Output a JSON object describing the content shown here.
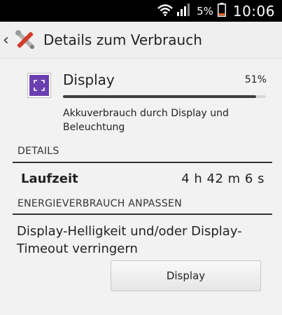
{
  "status_bar": {
    "battery_percent": "5%",
    "time": "10:06",
    "icons": [
      "wifi-icon",
      "signal-icon",
      "battery-icon"
    ]
  },
  "action_bar": {
    "title": "Details zum Verbrauch",
    "icons": [
      "back-caret-icon",
      "settings-tools-icon"
    ]
  },
  "usage": {
    "item_name": "Display",
    "percent_label": "51%",
    "bar_fraction": 0.95,
    "description": "Akkuverbrauch durch Display und Beleuchtung",
    "icon": "display-icon"
  },
  "details": {
    "header": "DETAILS",
    "rows": [
      {
        "label": "Laufzeit",
        "value": "4 h 42 m 6 s"
      }
    ]
  },
  "adjust": {
    "header": "ENERGIEVERBRAUCH ANPASSEN",
    "advice": "Display-Helligkeit und/oder Display-Timeout verringern",
    "button_label": "Display"
  },
  "colors": {
    "status_bar_bg": "#000000",
    "background": "#f2f2f2",
    "accent_icon": "#6a3fb0",
    "battery_low": "#e8621a"
  }
}
